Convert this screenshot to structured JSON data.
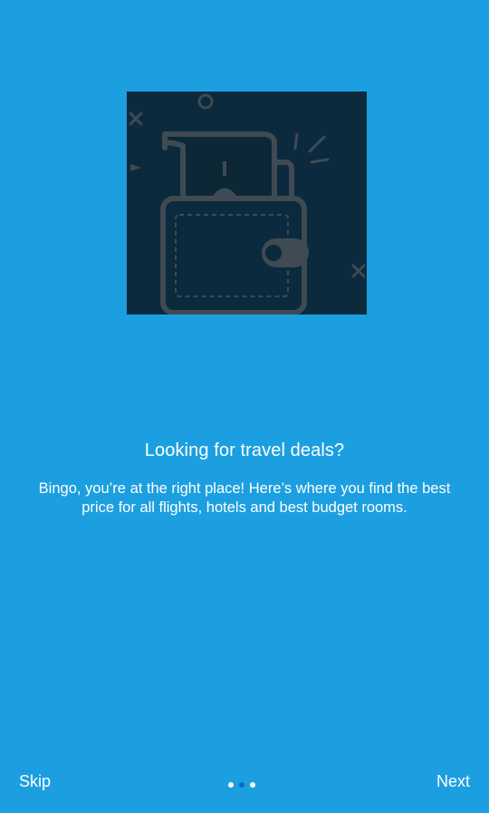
{
  "onboarding": {
    "title": "Looking for travel deals?",
    "description": "Bingo, you’re at the right place! Here’s where you find the best price for all flights, hotels and best budget rooms.",
    "illustration_icon": "wallet-with-tickets-icon"
  },
  "nav": {
    "skip_label": "Skip",
    "next_label": "Next",
    "page_count": 3,
    "current_page": 2
  },
  "colors": {
    "background": "#1c9fe0",
    "illustration_bg": "#0b2a3d",
    "dot_active": "#1565c0",
    "dot_inactive": "#ffffff",
    "text": "#ffffff"
  }
}
